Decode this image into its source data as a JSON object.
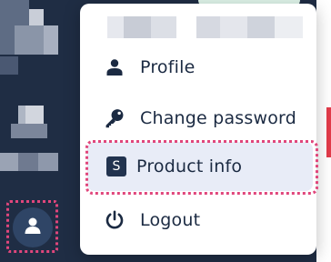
{
  "app": {
    "background": "#1f2d44",
    "accent_highlight": "#e0467c"
  },
  "avatar_button": {
    "icon": "user-icon"
  },
  "user_menu": {
    "header_redacted": true,
    "items": [
      {
        "label": "Profile",
        "icon": "person-icon"
      },
      {
        "label": "Change password",
        "icon": "key-icon"
      },
      {
        "label": "Product info",
        "icon": "s-badge-icon",
        "badge_letter": "S",
        "highlighted": true
      },
      {
        "label": "Logout",
        "icon": "power-icon"
      }
    ]
  }
}
